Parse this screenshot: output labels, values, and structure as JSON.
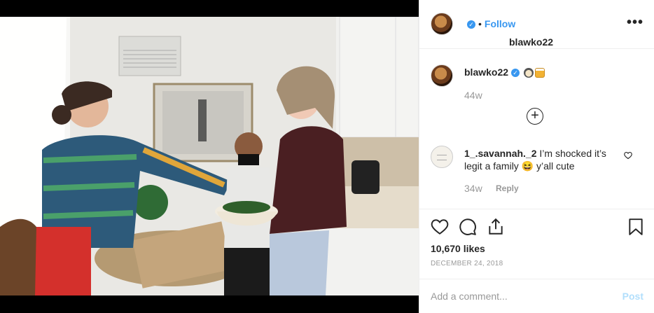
{
  "post": {
    "author": "blawko22",
    "follow_label": "Follow",
    "separator": "•",
    "more_label": "•••"
  },
  "caption": {
    "author": "blawko22",
    "emojis": [
      "cat-face-emoji",
      "beer-glass-emoji"
    ],
    "time": "44w",
    "expand_icon": "plus-circle-icon"
  },
  "comment": {
    "author": "1_.savannah._2",
    "text_part1": "I’m shocked it’s legit a family",
    "emoji": "grinning-squint-emoji",
    "text_part2": "y’all cute",
    "time": "34w",
    "reply_label": "Reply"
  },
  "actions": {
    "icons": [
      "heart-icon",
      "comment-icon",
      "share-icon",
      "bookmark-icon"
    ],
    "likes": "10,670 likes",
    "date": "DECEMBER 24, 2018"
  },
  "add_comment": {
    "placeholder": "Add a comment...",
    "post_label": "Post"
  },
  "colors": {
    "accent": "#3897f0",
    "post_disabled": "#b2dffc",
    "muted": "#999999",
    "border": "#efefef"
  }
}
